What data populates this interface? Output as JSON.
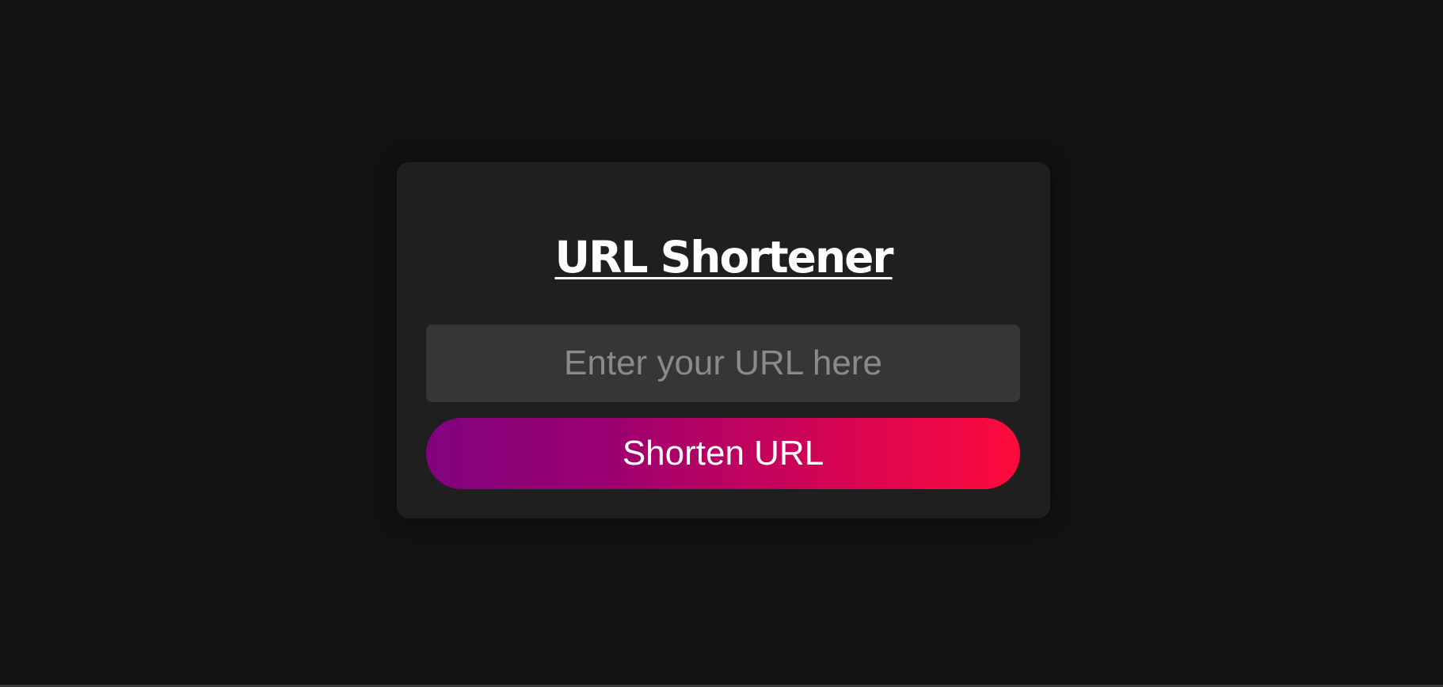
{
  "app": {
    "title": "URL Shortener"
  },
  "form": {
    "url_input": {
      "value": "",
      "placeholder": "Enter your URL here"
    },
    "submit_label": "Shorten URL"
  },
  "colors": {
    "background": "#121212",
    "card": "#1f1f1f",
    "input_background": "#363636",
    "button_gradient_start": "#82037f",
    "button_gradient_end": "#ff0a3c",
    "text_primary": "#ffffff",
    "placeholder": "#8a8a8a"
  }
}
